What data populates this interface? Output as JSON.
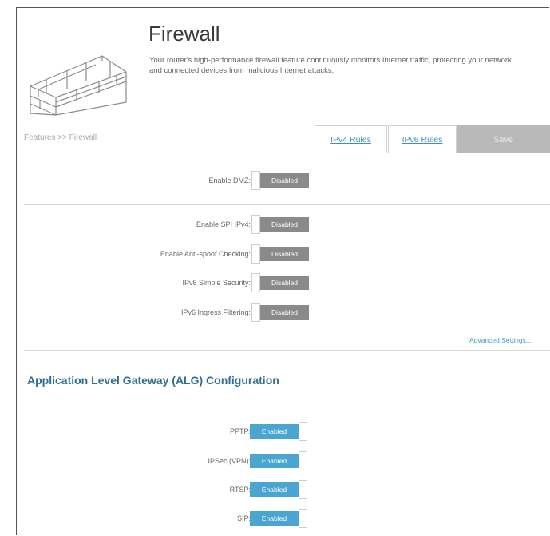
{
  "header": {
    "title": "Firewall",
    "description": "Your router's high-performance firewall feature continuously monitors Internet traffic, protecting your network and connected devices from malicious Internet attacks."
  },
  "breadcrumb": "Features >> Firewall",
  "toolbar": {
    "ipv4_rules": "IPv4 Rules",
    "ipv6_rules": "IPv6 Rules",
    "save": "Save"
  },
  "firewall": {
    "dmz": {
      "label": "Enable DMZ:",
      "state": "Disabled"
    },
    "settings": [
      {
        "label": "Enable SPI IPv4:",
        "state": "Disabled"
      },
      {
        "label": "Enable Anti-spoof Checking:",
        "state": "Disabled"
      },
      {
        "label": "IPv6 Simple Security:",
        "state": "Disabled"
      },
      {
        "label": "IPv6 Ingress Filtering:",
        "state": "Disabled"
      }
    ],
    "advanced_link": "Advanced Settings..."
  },
  "alg": {
    "title": "Application Level Gateway (ALG) Configuration",
    "items": [
      {
        "label": "PPTP:",
        "state": "Enabled"
      },
      {
        "label": "IPSec (VPN):",
        "state": "Enabled"
      },
      {
        "label": "RTSP:",
        "state": "Enabled"
      },
      {
        "label": "SIP:",
        "state": "Enabled"
      }
    ]
  },
  "colors": {
    "enabled": "#4aa5d0",
    "disabled": "#8a8a8a",
    "link": "#3f8fc0",
    "heading": "#2f6f8f"
  },
  "icons": {
    "logo": "brick-wall-icon"
  }
}
